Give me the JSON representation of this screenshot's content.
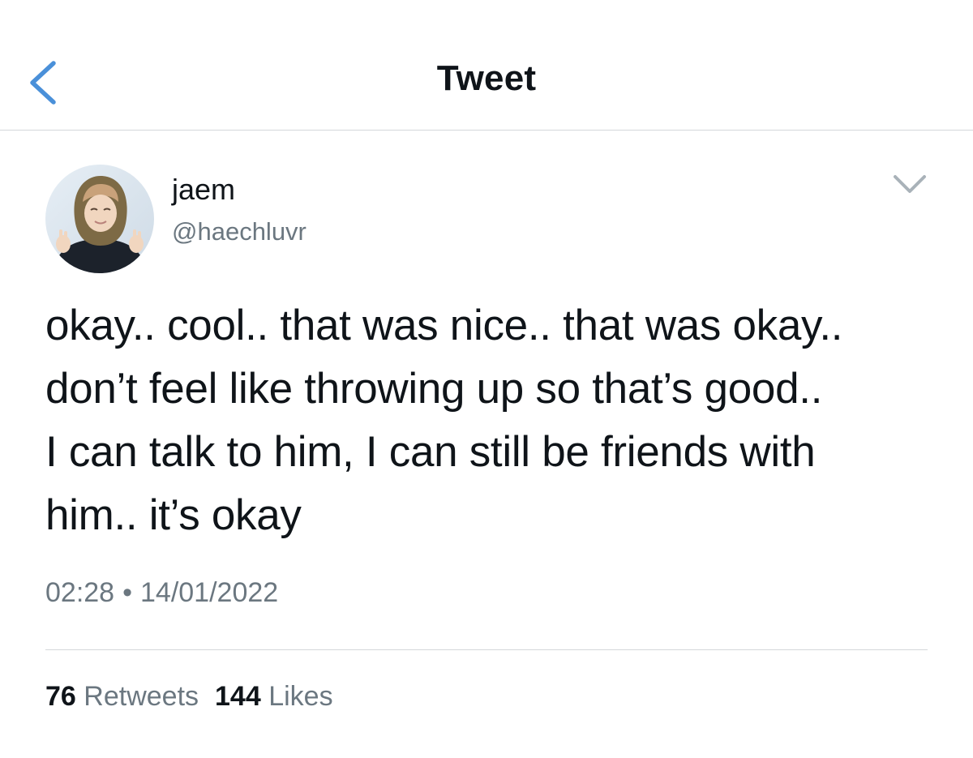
{
  "header": {
    "title": "Tweet",
    "back_icon": "chevron-left-icon",
    "accent_color": "#4a90d9"
  },
  "author": {
    "display_name": "jaem",
    "handle": "@haechluvr",
    "avatar": "profile-photo"
  },
  "tweet": {
    "lines": [
      "okay.. cool.. that was nice.. that was okay..",
      "don’t feel like throwing up so that’s good..",
      "I can talk to him, I can still be friends with",
      "him.. it’s okay"
    ],
    "time": "02:28",
    "separator": "•",
    "date": "14/01/2022"
  },
  "stats": {
    "retweets_count": "76",
    "retweets_label": "Retweets",
    "likes_count": "144",
    "likes_label": "Likes"
  },
  "colors": {
    "text_primary": "#0f1419",
    "text_secondary": "#6b7780",
    "divider": "#d4d7da",
    "background": "#ffffff"
  }
}
